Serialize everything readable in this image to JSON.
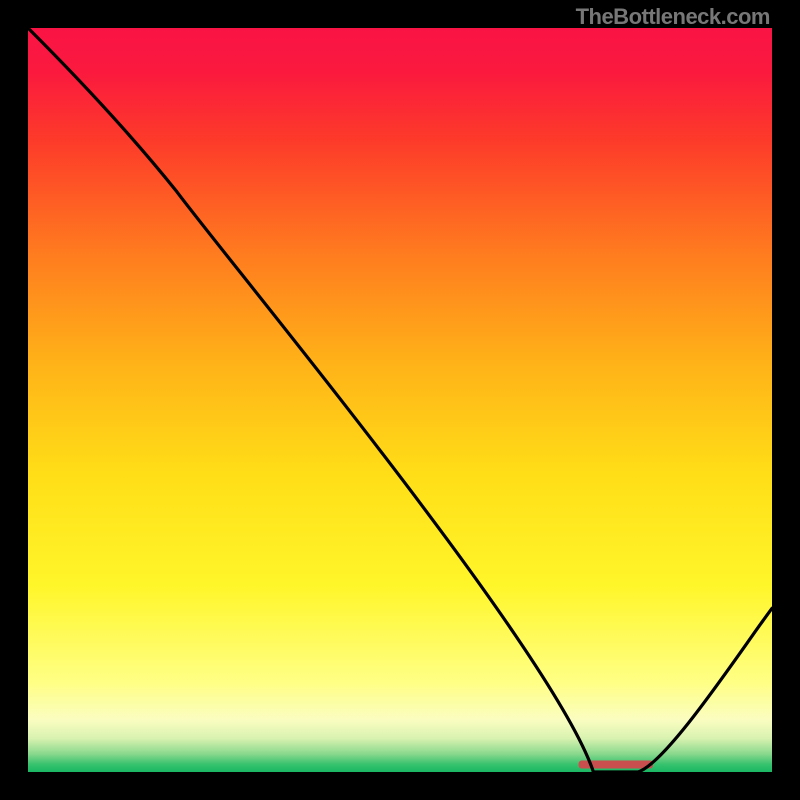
{
  "attribution": "TheBottleneck.com",
  "chart_data": {
    "type": "line",
    "title": "",
    "xlabel": "",
    "ylabel": "",
    "xlim": [
      0,
      100
    ],
    "ylim": [
      0,
      100
    ],
    "x": [
      0,
      20,
      76,
      82,
      100
    ],
    "values": [
      100,
      78,
      0,
      0,
      22
    ],
    "note": "Curve represents bottleneck percentage vs configuration; background gradient from green (low, bottom) through yellow/orange to red (high, top).",
    "gradient_stops": [
      {
        "pos": 0.0,
        "color": "#f91345"
      },
      {
        "pos": 0.06,
        "color": "#fb1a3e"
      },
      {
        "pos": 0.15,
        "color": "#fd3a2a"
      },
      {
        "pos": 0.3,
        "color": "#ff7a1f"
      },
      {
        "pos": 0.45,
        "color": "#ffb218"
      },
      {
        "pos": 0.6,
        "color": "#ffde17"
      },
      {
        "pos": 0.75,
        "color": "#fff62a"
      },
      {
        "pos": 0.88,
        "color": "#ffff85"
      },
      {
        "pos": 0.93,
        "color": "#fafdc0"
      },
      {
        "pos": 0.955,
        "color": "#d8f2b0"
      },
      {
        "pos": 0.975,
        "color": "#8cd98e"
      },
      {
        "pos": 0.99,
        "color": "#36c26d"
      },
      {
        "pos": 1.0,
        "color": "#1ab864"
      }
    ],
    "marker": {
      "x_start": 74,
      "x_end": 84,
      "y": 1,
      "color": "#c94f4f"
    }
  }
}
